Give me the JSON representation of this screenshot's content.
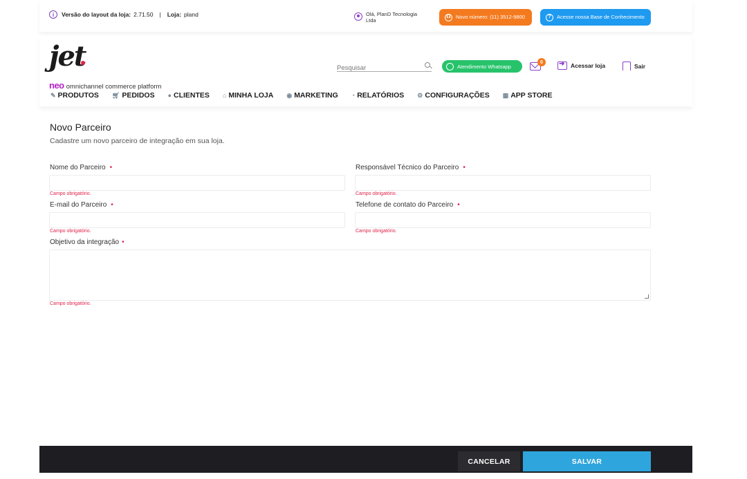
{
  "topbar": {
    "version_label": "Versão do layout da loja:",
    "version_value": "2.71.50",
    "separator": "|",
    "store_label": "Loja:",
    "store_value": "pland",
    "greeting": "Olá, PlanD Tecnologia Ltda",
    "phone_pill": "Novo número: (11) 3512-9800",
    "kb_pill": "Acesse nossa Base de Conhecimento"
  },
  "header": {
    "logo_text": "jet",
    "logo_neo": "neo",
    "logo_tagline": "omnichannel commerce platform",
    "search_placeholder": "Pesquisar",
    "whatsapp_label": "Atendimento Whatsapp",
    "mail_badge": "0",
    "store_link": "Acessar loja",
    "logout_link": "Sair"
  },
  "nav": [
    {
      "icon": "edit-icon",
      "glyph": "✎",
      "label": "PRODUTOS"
    },
    {
      "icon": "cart-icon",
      "glyph": "🛒︎",
      "label": "PEDIDOS"
    },
    {
      "icon": "user-icon",
      "glyph": "●",
      "label": "CLIENTES"
    },
    {
      "icon": "store-icon",
      "glyph": "⌂",
      "label": "MINHA LOJA"
    },
    {
      "icon": "marketing-icon",
      "glyph": "◉",
      "label": "MARKETING"
    },
    {
      "icon": "chart-icon",
      "glyph": "◔",
      "label": "RELATÓRIOS"
    },
    {
      "icon": "gear-icon",
      "glyph": "⚙",
      "label": "CONFIGURAÇÕES"
    },
    {
      "icon": "appstore-icon",
      "glyph": "▦",
      "label": "APP STORE"
    }
  ],
  "form": {
    "title": "Novo Parceiro",
    "subtitle": "Cadastre um novo parceiro de integração em sua loja.",
    "required_mark": "•",
    "fields": {
      "partner_name": {
        "label": "Nome do Parceiro",
        "value": ""
      },
      "tech_contact": {
        "label": "Responsável Técnico do Parceiro",
        "value": ""
      },
      "partner_email": {
        "label": "E-mail do Parceiro",
        "value": ""
      },
      "partner_phone": {
        "label": "Telefone de contato do Parceiro",
        "value": ""
      },
      "integration_goal": {
        "label": "Objetivo da integração",
        "value": ""
      }
    },
    "error_text": "Campo obrigatório."
  },
  "footer": {
    "cancel_label": "CANCELAR",
    "save_label": "SALVAR"
  }
}
